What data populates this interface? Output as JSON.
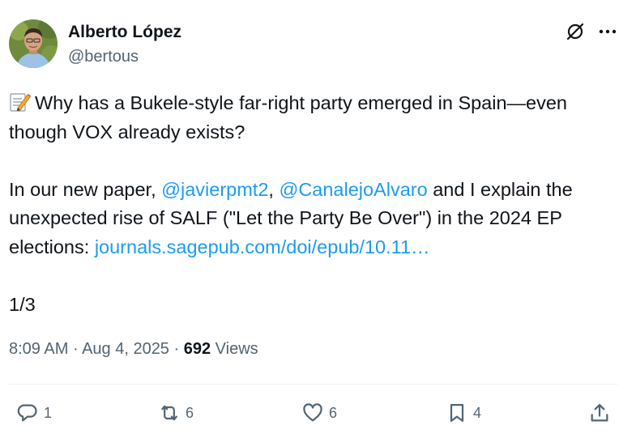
{
  "author": {
    "display_name": "Alberto López",
    "handle": "@bertous",
    "avatar_icon": "avatar-photo"
  },
  "header_icons": [
    "grok-icon",
    "more-icon"
  ],
  "post": {
    "line1_emoji": "memo-icon",
    "line1_text": "Why has a Bukele-style far-right party emerged in Spain—even though VOX already exists?",
    "para2_prefix": "In our new paper, ",
    "mention1": "@javierpmt2",
    "sep": ", ",
    "mention2": "@CanalejoAlvaro",
    "para2_mid": " and I explain the unexpected rise of SALF (\"Let the Party Be Over\") in the 2024 EP elections: ",
    "link": "journals.sagepub.com/doi/epub/10.11…",
    "thread_marker": "1/3"
  },
  "meta": {
    "time": "8:09 AM",
    "dot1": " · ",
    "date": "Aug 4, 2025",
    "dot2": " · ",
    "views_count": "692",
    "views_label": " Views"
  },
  "actions": {
    "replies": "1",
    "reposts": "6",
    "likes": "6",
    "bookmarks": "4"
  },
  "colors": {
    "text": "#0f1419",
    "secondary": "#536471",
    "link": "#1d9bf0",
    "divider": "#eff3f4"
  }
}
